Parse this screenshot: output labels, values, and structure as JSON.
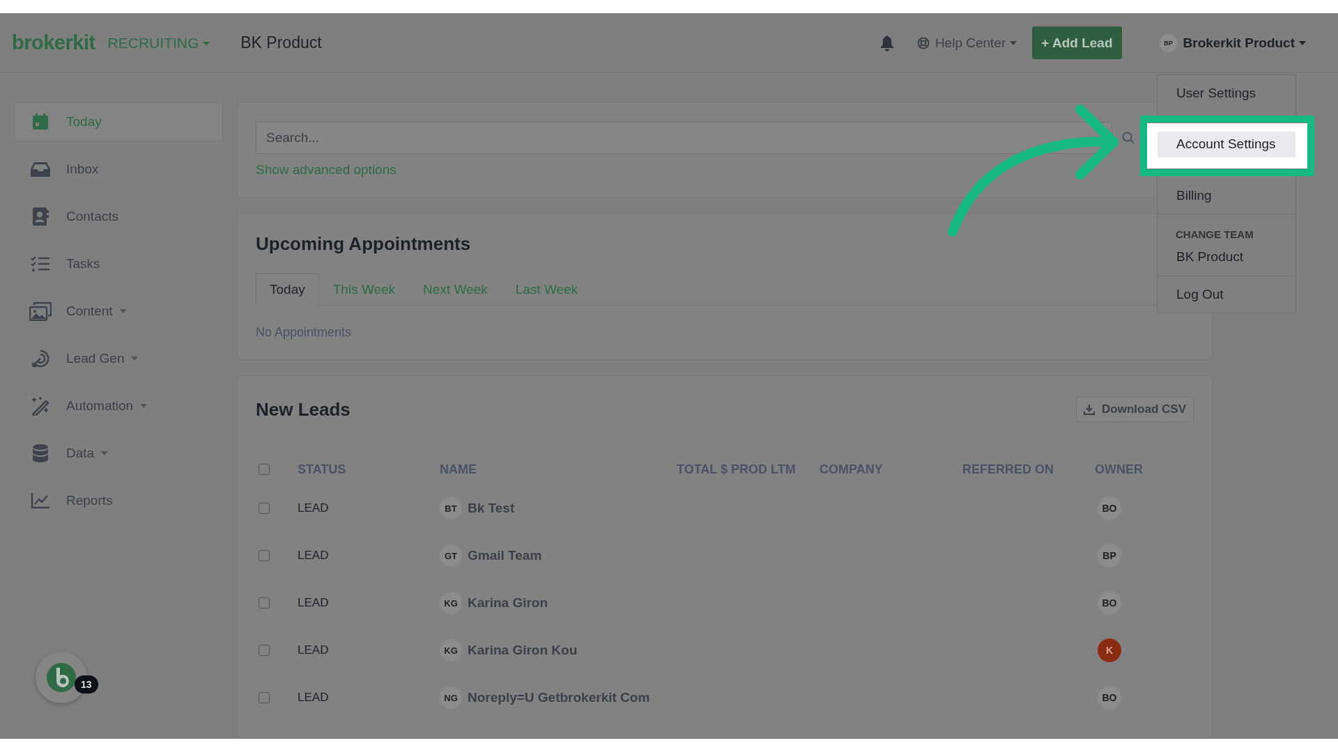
{
  "header": {
    "logo": "brokerkit",
    "app_switcher": "RECRUITING",
    "team": "BK Product",
    "help": "Help Center",
    "add_lead": "+ Add Lead",
    "user": {
      "initials": "BP",
      "name": "Brokerkit Product"
    }
  },
  "sidebar": {
    "items": [
      {
        "label": "Today",
        "selected": true,
        "expandable": false
      },
      {
        "label": "Inbox",
        "selected": false,
        "expandable": false
      },
      {
        "label": "Contacts",
        "selected": false,
        "expandable": false
      },
      {
        "label": "Tasks",
        "selected": false,
        "expandable": false
      },
      {
        "label": "Content",
        "selected": false,
        "expandable": true
      },
      {
        "label": "Lead Gen",
        "selected": false,
        "expandable": true
      },
      {
        "label": "Automation",
        "selected": false,
        "expandable": true
      },
      {
        "label": "Data",
        "selected": false,
        "expandable": true
      },
      {
        "label": "Reports",
        "selected": false,
        "expandable": false
      }
    ]
  },
  "search": {
    "placeholder": "Search...",
    "advanced": "Show advanced options"
  },
  "appointments": {
    "title": "Upcoming Appointments",
    "tabs": [
      {
        "label": "Today",
        "selected": true
      },
      {
        "label": "This Week",
        "selected": false
      },
      {
        "label": "Next Week",
        "selected": false
      },
      {
        "label": "Last Week",
        "selected": false
      }
    ],
    "empty": "No Appointments"
  },
  "leads": {
    "title": "New Leads",
    "download": "Download CSV",
    "select_all": false,
    "columns": [
      "STATUS",
      "NAME",
      "TOTAL $ PROD LTM",
      "COMPANY",
      "REFERRED ON",
      "OWNER"
    ],
    "rows": [
      {
        "checked": false,
        "status": "LEAD",
        "initials": "BT",
        "name": "Bk Test",
        "owner": {
          "initials": "BO",
          "color": "#8c8c8c"
        }
      },
      {
        "checked": false,
        "status": "LEAD",
        "initials": "GT",
        "name": "Gmail Team",
        "owner": {
          "initials": "BP",
          "color": "#8c8c8c"
        }
      },
      {
        "checked": false,
        "status": "LEAD",
        "initials": "KG",
        "name": "Karina Giron",
        "owner": {
          "initials": "BO",
          "color": "#8c8c8c"
        }
      },
      {
        "checked": false,
        "status": "LEAD",
        "initials": "KG",
        "name": "Karina Giron Kou",
        "owner": {
          "initials": "K",
          "color": "#8a2c13"
        }
      },
      {
        "checked": false,
        "status": "LEAD",
        "initials": "NG",
        "name": "Noreply=U Getbrokerkit Com",
        "owner": {
          "initials": "BO",
          "color": "#8c8c8c"
        }
      }
    ]
  },
  "user_menu": {
    "items": [
      {
        "kind": "item",
        "label": "User Settings",
        "selected": false
      },
      {
        "kind": "item",
        "label": "Account Settings",
        "selected": true
      },
      {
        "kind": "item",
        "label": "Billing",
        "selected": false
      },
      {
        "kind": "divider"
      },
      {
        "kind": "header",
        "label": "CHANGE TEAM"
      },
      {
        "kind": "item",
        "label": "BK Product",
        "selected": false
      },
      {
        "kind": "divider"
      },
      {
        "kind": "item",
        "label": "Log Out",
        "selected": false
      }
    ]
  },
  "chat": {
    "count": "13"
  }
}
